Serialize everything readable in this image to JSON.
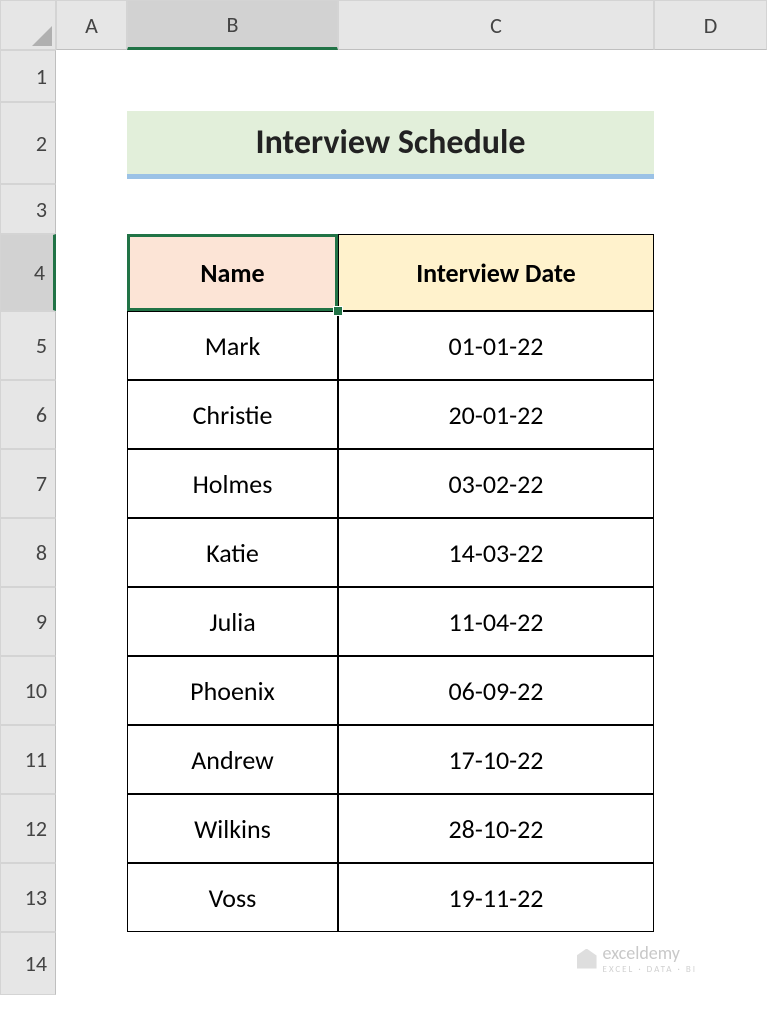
{
  "columns": [
    "A",
    "B",
    "C",
    "D"
  ],
  "rows": [
    "1",
    "2",
    "3",
    "4",
    "5",
    "6",
    "7",
    "8",
    "9",
    "10",
    "11",
    "12",
    "13",
    "14"
  ],
  "activeCol": "B",
  "activeRow": "4",
  "title": "Interview Schedule",
  "headers": {
    "name": "Name",
    "date": "Interview Date"
  },
  "data": [
    {
      "name": "Mark",
      "date": "01-01-22"
    },
    {
      "name": "Christie",
      "date": "20-01-22"
    },
    {
      "name": "Holmes",
      "date": "03-02-22"
    },
    {
      "name": "Katie",
      "date": "14-03-22"
    },
    {
      "name": "Julia",
      "date": "11-04-22"
    },
    {
      "name": "Phoenix",
      "date": "06-09-22"
    },
    {
      "name": "Andrew",
      "date": "17-10-22"
    },
    {
      "name": "Wilkins",
      "date": "28-10-22"
    },
    {
      "name": "Voss",
      "date": "19-11-22"
    }
  ],
  "watermark": {
    "brand": "exceldemy",
    "tag": "EXCEL · DATA · BI"
  }
}
